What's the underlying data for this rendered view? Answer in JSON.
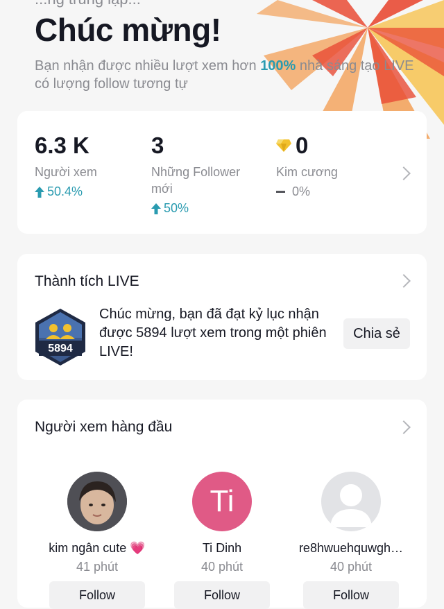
{
  "header": {
    "top_fragment": "...ng trung lập...",
    "title": "Chúc mừng!",
    "subtitle_pre": "Bạn nhận được nhiều lượt xem hơn ",
    "subtitle_highlight": "100%",
    "subtitle_post": " nhà sáng tạo LIVE có lượng follow tương tự"
  },
  "stats": {
    "viewers": {
      "value": "6.3 K",
      "label": "Người xem",
      "delta": "50.4%"
    },
    "followers": {
      "value": "3",
      "label_line1": "Những Follower",
      "label_line2": "mới",
      "delta": "50%"
    },
    "diamonds": {
      "value": "0",
      "label": "Kim cương",
      "delta": "0%"
    }
  },
  "achievements": {
    "heading": "Thành tích LIVE",
    "badge_number": "5894",
    "text": "Chúc mừng, bạn đã đạt kỷ lục nhận được 5894 lượt xem trong một phiên LIVE!",
    "share_label": "Chia sẻ"
  },
  "top_viewers": {
    "heading": "Người xem hàng đầu",
    "items": [
      {
        "name": "kim ngân cute 💗",
        "time": "41 phút",
        "initials": ""
      },
      {
        "name": "Ti Dinh",
        "time": "40 phút",
        "initials": "Ti"
      },
      {
        "name": "re8hwuehquwgh…",
        "time": "40 phút",
        "initials": ""
      }
    ],
    "follow_label": "Follow"
  },
  "colors": {
    "accent_teal": "#2a9bb0",
    "avatar_pink": "#e05a86",
    "burst_red": "#e94b35",
    "burst_orange": "#f39a4b",
    "burst_yellow": "#f7c65a"
  }
}
